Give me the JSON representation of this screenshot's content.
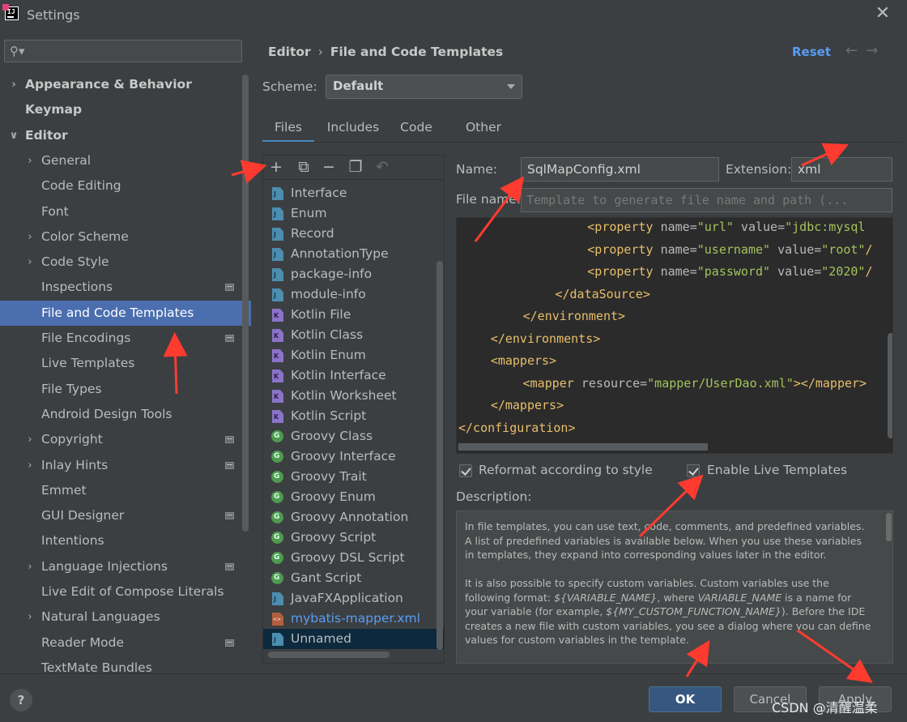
{
  "window": {
    "title": "Settings"
  },
  "search": {
    "placeholder": ""
  },
  "sidebar": {
    "items": [
      {
        "label": "Appearance & Behavior",
        "level": 0,
        "chevron": "right",
        "bold": true,
        "project": false
      },
      {
        "label": "Keymap",
        "level": 0,
        "chevron": "none",
        "bold": true,
        "project": false
      },
      {
        "label": "Editor",
        "level": 0,
        "chevron": "down",
        "bold": true,
        "project": false
      },
      {
        "label": "General",
        "level": 1,
        "chevron": "right",
        "bold": false,
        "project": false
      },
      {
        "label": "Code Editing",
        "level": 1,
        "chevron": "none",
        "bold": false,
        "project": false
      },
      {
        "label": "Font",
        "level": 1,
        "chevron": "none",
        "bold": false,
        "project": false
      },
      {
        "label": "Color Scheme",
        "level": 1,
        "chevron": "right",
        "bold": false,
        "project": false
      },
      {
        "label": "Code Style",
        "level": 1,
        "chevron": "right",
        "bold": false,
        "project": false
      },
      {
        "label": "Inspections",
        "level": 1,
        "chevron": "none",
        "bold": false,
        "project": true
      },
      {
        "label": "File and Code Templates",
        "level": 1,
        "chevron": "none",
        "bold": false,
        "project": false,
        "selected": true
      },
      {
        "label": "File Encodings",
        "level": 1,
        "chevron": "none",
        "bold": false,
        "project": true
      },
      {
        "label": "Live Templates",
        "level": 1,
        "chevron": "none",
        "bold": false,
        "project": false
      },
      {
        "label": "File Types",
        "level": 1,
        "chevron": "none",
        "bold": false,
        "project": false
      },
      {
        "label": "Android Design Tools",
        "level": 1,
        "chevron": "none",
        "bold": false,
        "project": false
      },
      {
        "label": "Copyright",
        "level": 1,
        "chevron": "right",
        "bold": false,
        "project": true
      },
      {
        "label": "Inlay Hints",
        "level": 1,
        "chevron": "right",
        "bold": false,
        "project": true
      },
      {
        "label": "Emmet",
        "level": 1,
        "chevron": "none",
        "bold": false,
        "project": false
      },
      {
        "label": "GUI Designer",
        "level": 1,
        "chevron": "none",
        "bold": false,
        "project": true
      },
      {
        "label": "Intentions",
        "level": 1,
        "chevron": "none",
        "bold": false,
        "project": false
      },
      {
        "label": "Language Injections",
        "level": 1,
        "chevron": "right",
        "bold": false,
        "project": true
      },
      {
        "label": "Live Edit of Compose Literals",
        "level": 1,
        "chevron": "none",
        "bold": false,
        "project": false
      },
      {
        "label": "Natural Languages",
        "level": 1,
        "chevron": "right",
        "bold": false,
        "project": false
      },
      {
        "label": "Reader Mode",
        "level": 1,
        "chevron": "none",
        "bold": false,
        "project": true
      },
      {
        "label": "TextMate Bundles",
        "level": 1,
        "chevron": "none",
        "bold": false,
        "project": false
      }
    ]
  },
  "header": {
    "breadcrumb": [
      "Editor",
      "File and Code Templates"
    ],
    "reset_label": "Reset"
  },
  "scheme": {
    "label": "Scheme:",
    "value": "Default"
  },
  "tabs": [
    "Files",
    "Includes",
    "Code",
    "Other"
  ],
  "templates": [
    {
      "label": "Interface",
      "icon": "java"
    },
    {
      "label": "Enum",
      "icon": "java"
    },
    {
      "label": "Record",
      "icon": "java"
    },
    {
      "label": "AnnotationType",
      "icon": "java"
    },
    {
      "label": "package-info",
      "icon": "java"
    },
    {
      "label": "module-info",
      "icon": "java"
    },
    {
      "label": "Kotlin File",
      "icon": "kotlin"
    },
    {
      "label": "Kotlin Class",
      "icon": "kotlin"
    },
    {
      "label": "Kotlin Enum",
      "icon": "kotlin"
    },
    {
      "label": "Kotlin Interface",
      "icon": "kotlin"
    },
    {
      "label": "Kotlin Worksheet",
      "icon": "kotlin"
    },
    {
      "label": "Kotlin Script",
      "icon": "kotlin"
    },
    {
      "label": "Groovy Class",
      "icon": "groovy"
    },
    {
      "label": "Groovy Interface",
      "icon": "groovy"
    },
    {
      "label": "Groovy Trait",
      "icon": "groovy"
    },
    {
      "label": "Groovy Enum",
      "icon": "groovy"
    },
    {
      "label": "Groovy Annotation",
      "icon": "groovy"
    },
    {
      "label": "Groovy Script",
      "icon": "groovy"
    },
    {
      "label": "Groovy DSL Script",
      "icon": "groovy"
    },
    {
      "label": "Gant Script",
      "icon": "groovy"
    },
    {
      "label": "JavaFXApplication",
      "icon": "java"
    },
    {
      "label": "mybatis-mapper.xml",
      "icon": "xml",
      "highlight": true
    },
    {
      "label": "Unnamed",
      "icon": "java",
      "selected": true
    }
  ],
  "editor": {
    "name_label": "Name:",
    "name_value": "SqlMapConfig.xml",
    "extension_label": "Extension:",
    "extension_value": "xml",
    "filename_label": "File name:",
    "filename_placeholder": "Template to generate file name and path (...",
    "code_lines": [
      {
        "indent": 16,
        "parts": [
          [
            "tg",
            "<property "
          ],
          [
            "at",
            "name="
          ],
          [
            "st",
            "\"url\""
          ],
          [
            "at",
            " value="
          ],
          [
            "st",
            "\"jdbc:mysql"
          ]
        ]
      },
      {
        "indent": 16,
        "parts": [
          [
            "tg",
            "<property "
          ],
          [
            "at",
            "name="
          ],
          [
            "st",
            "\"username\""
          ],
          [
            "at",
            " value="
          ],
          [
            "st",
            "\"root\""
          ],
          [
            "pl",
            "/"
          ]
        ]
      },
      {
        "indent": 16,
        "parts": [
          [
            "tg",
            "<property "
          ],
          [
            "at",
            "name="
          ],
          [
            "st",
            "\"password\""
          ],
          [
            "at",
            " value="
          ],
          [
            "st",
            "\"2020\""
          ],
          [
            "pl",
            "/"
          ]
        ]
      },
      {
        "indent": 12,
        "parts": [
          [
            "tg",
            "</dataSource>"
          ]
        ]
      },
      {
        "indent": 8,
        "parts": [
          [
            "tg",
            "</environment>"
          ]
        ]
      },
      {
        "indent": 4,
        "parts": [
          [
            "tg",
            "</environments>"
          ]
        ]
      },
      {
        "indent": 4,
        "parts": [
          [
            "tg",
            "<mappers>"
          ]
        ]
      },
      {
        "indent": 8,
        "parts": [
          [
            "tg",
            "<mapper "
          ],
          [
            "at",
            "resource="
          ],
          [
            "st",
            "\"mapper/UserDao.xml\""
          ],
          [
            "tg",
            "></mapper>"
          ]
        ]
      },
      {
        "indent": 4,
        "parts": [
          [
            "tg",
            "</mappers>"
          ]
        ]
      },
      {
        "indent": 0,
        "parts": [
          [
            "tg",
            "</configuration>"
          ]
        ]
      }
    ],
    "reformat_label": "Reformat according to style",
    "reformat_checked": true,
    "live_templates_label": "Enable Live Templates",
    "live_templates_checked": true
  },
  "description": {
    "label": "Description:",
    "para1": "In file templates, you can use text, code, comments, and predefined variables. A list of predefined variables is available below. When you use these variables in templates, they expand into corresponding values later in the editor.",
    "para2_a": "It is also possible to specify custom variables. Custom variables use the following format: ",
    "para2_var1": "${VARIABLE_NAME}",
    "para2_b": ", where ",
    "para2_var2": "VARIABLE_NAME",
    "para2_c": " is a name for your variable (for example, ",
    "para2_var3": "${MY_CUSTOM_FUNCTION_NAME}",
    "para2_d": "). Before the IDE creates a new file with custom variables, you see a dialog where you can define values for custom variables in the template."
  },
  "footer": {
    "help": "?",
    "ok": "OK",
    "cancel": "Cancel",
    "apply": "Apply",
    "watermark": "CSDN @清醒温柔"
  },
  "colors": {
    "accent": "#4b6eaf",
    "link": "#589df6",
    "annotation_arrow": "#ff3b30",
    "default_button": "#365880"
  }
}
